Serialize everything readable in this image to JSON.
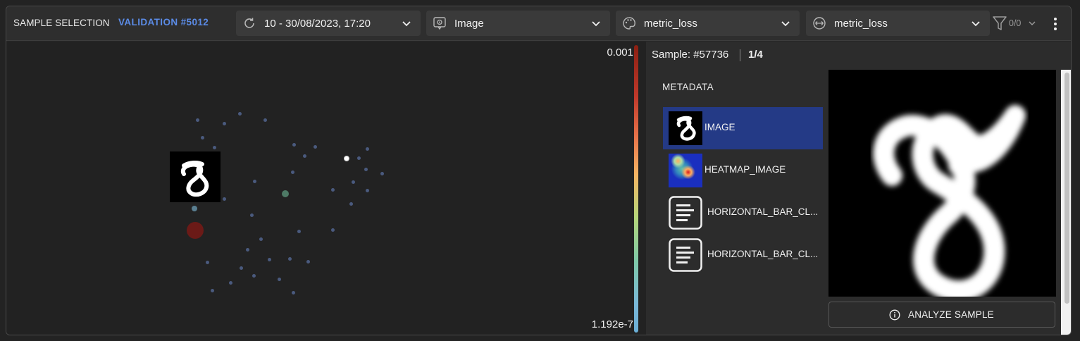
{
  "header": {
    "title": "SAMPLE SELECTION",
    "subtitle": "VALIDATION #5012",
    "filter_count": "0/0"
  },
  "dropdowns": [
    {
      "label": "10 - 30/08/2023, 17:20",
      "icon": "refresh-icon"
    },
    {
      "label": "Image",
      "icon": "image-settings-icon"
    },
    {
      "label": "metric_loss",
      "icon": "palette-icon"
    },
    {
      "label": "metric_loss",
      "icon": "size-arrows-icon"
    }
  ],
  "scatter": {
    "scale_max": "0.001",
    "scale_min": "1.192e-7",
    "highlight_color": "#6b1a17",
    "selected_color": "#ffffff",
    "point_color": "#4a5a7e"
  },
  "panel": {
    "sample_label": "Sample: #57736",
    "sample_count": "1/4",
    "metadata_heading": "METADATA",
    "items": [
      {
        "label": "IMAGE",
        "icon": "digit-thumbnail",
        "selected": true
      },
      {
        "label": "HEATMAP_IMAGE",
        "icon": "heatmap-thumbnail",
        "selected": false
      },
      {
        "label": "HORIZONTAL_BAR_CL...",
        "icon": "text-lines-icon",
        "selected": false
      },
      {
        "label": "HORIZONTAL_BAR_CL...",
        "icon": "text-lines-icon",
        "selected": false
      }
    ],
    "analyze_label": "ANALYZE SAMPLE",
    "selection_color": "#243a86"
  }
}
